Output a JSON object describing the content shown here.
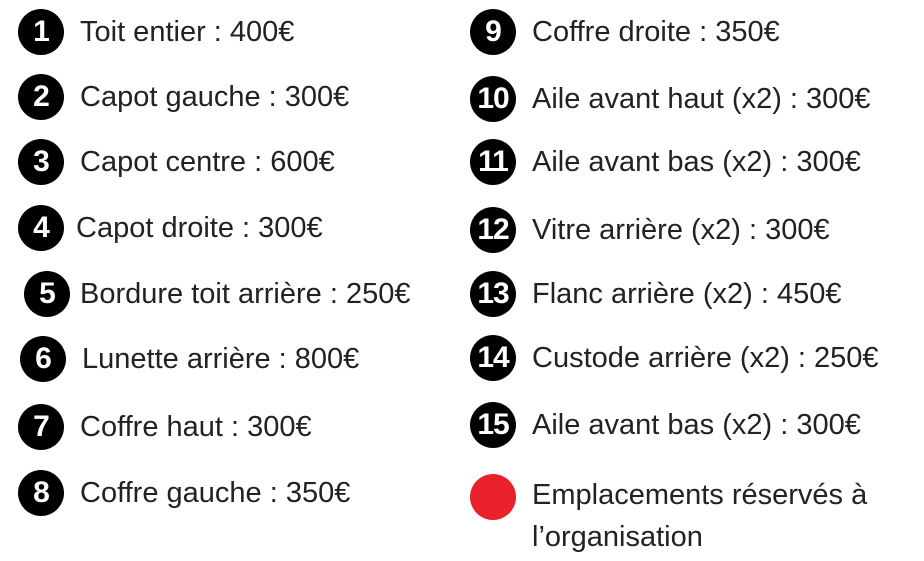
{
  "left_items": [
    {
      "number": "1",
      "label": "Toit entier : 400€"
    },
    {
      "number": "2",
      "label": "Capot gauche : 300€"
    },
    {
      "number": "3",
      "label": "Capot centre : 600€"
    },
    {
      "number": "4",
      "label": "Capot droite : 300€"
    },
    {
      "number": "5",
      "label": "Bordure toit arrière : 250€"
    },
    {
      "number": "6",
      "label": "Lunette arrière : 800€"
    },
    {
      "number": "7",
      "label": "Coffre haut : 300€"
    },
    {
      "number": "8",
      "label": "Coffre gauche : 350€"
    }
  ],
  "right_items": [
    {
      "number": "9",
      "label": "Coffre droite : 350€"
    },
    {
      "number": "10",
      "label": "Aile avant haut (x2) : 300€"
    },
    {
      "number": "11",
      "label": "Aile avant bas (x2) : 300€"
    },
    {
      "number": "12",
      "label": "Vitre arrière (x2) : 300€"
    },
    {
      "number": "13",
      "label": "Flanc arrière (x2) : 450€"
    },
    {
      "number": "14",
      "label": "Custode arrière (x2) : 250€"
    },
    {
      "number": "15",
      "label": "Aile avant bas (x2) : 300€"
    }
  ],
  "legend": {
    "line1": "Emplacements réservés à",
    "line2": "l’organisation",
    "color": "#e8212a"
  }
}
